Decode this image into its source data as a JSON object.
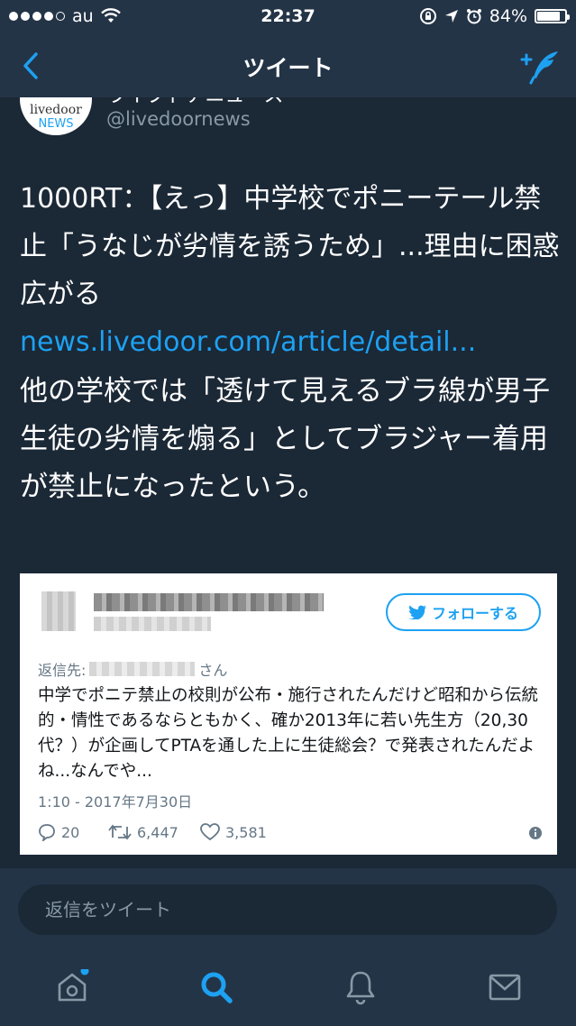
{
  "status_bar": {
    "carrier": "au",
    "time": "22:37",
    "battery": "84%",
    "battery_level": 0.84
  },
  "nav": {
    "title": "ツイート"
  },
  "tweet": {
    "author_name": "ライブドアニュース",
    "handle": "@livedoornews",
    "avatar_top": "livedoor",
    "avatar_bottom": "NEWS",
    "headline": "1000RT：【えっ】中学校でポニーテール禁止「うなじが劣情を誘うため」...理由に困惑広がる",
    "link": "news.livedoor.com/article/detail...",
    "body": "他の学校では「透けて見えるブラ線が男子生徒の劣情を煽る」としてブラジャー着用が禁止になったという。"
  },
  "embed": {
    "follow_label": "フォローする",
    "reply_prefix": "返信先:",
    "reply_suffix": "さん",
    "body": "中学でポニテ禁止の校則が公布・施行されたんだけど昭和から伝統的・情性であるならともかく、確か2013年に若い先生方（20,30代？）が企画してPTAを通した上に生徒総会？で発表されたんだよね...なんでや...",
    "timestamp": "1:10 - 2017年7月30日",
    "replies": "20",
    "retweets": "6,447",
    "likes": "3,581"
  },
  "reply_bar": {
    "placeholder": "返信をツイート"
  },
  "tab_bar": {
    "items": [
      {
        "name": "home-icon",
        "has_badge": true
      },
      {
        "name": "search-icon",
        "active": true
      },
      {
        "name": "notifications-icon"
      },
      {
        "name": "messages-icon"
      }
    ]
  },
  "colors": {
    "background": "#1b2836",
    "bar": "#243447",
    "accent": "#1da1f2",
    "muted": "#8899a6"
  }
}
